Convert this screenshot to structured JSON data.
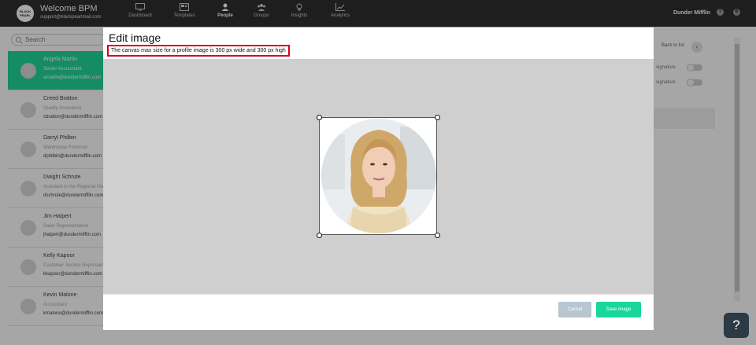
{
  "header": {
    "logo_text": "BLACK PEARL",
    "welcome": "Welcome BPM",
    "support_email": "support@blackpearlmail.com",
    "nav": [
      {
        "label": "Dashboard",
        "icon": "monitor-icon"
      },
      {
        "label": "Templates",
        "icon": "template-icon"
      },
      {
        "label": "People",
        "icon": "person-icon"
      },
      {
        "label": "Groups",
        "icon": "groups-icon"
      },
      {
        "label": "Insights",
        "icon": "lightbulb-icon"
      },
      {
        "label": "Analytics",
        "icon": "chart-icon"
      }
    ],
    "active_nav": "People",
    "company": "Dunder Mifflin",
    "help_icon_glyph": "?",
    "settings_icon_glyph": "⚙"
  },
  "search": {
    "placeholder": "Search"
  },
  "people": [
    {
      "name": "Angela Martin",
      "role": "Senior Accountant",
      "email": "amartin@dundermifflin.com"
    },
    {
      "name": "Creed Bratton",
      "role": "Quality Assurance",
      "email": "cbratton@dundermifflin.com"
    },
    {
      "name": "Darryl Philbin",
      "role": "Warehouse Foreman",
      "email": "dphilbin@dundermifflin.com"
    },
    {
      "name": "Dwight Schrute",
      "role": "Assistant to the Regional Manager",
      "email": "dschrute@dundermifflin.com"
    },
    {
      "name": "Jim Halpert",
      "role": "Sales Representative",
      "email": "jhalpert@dundermifflin.com"
    },
    {
      "name": "Kelly Kapoor",
      "role": "Customer Service Representative",
      "email": "kkapoor@dundermifflin.com"
    },
    {
      "name": "Kevin Malone",
      "role": "Accountant",
      "email": "kmalone@dundermifflin.com"
    }
  ],
  "right_panel": {
    "back_label": "Back to list",
    "back_icon_glyph": "‹",
    "sig_rows": [
      "signature",
      "signature"
    ]
  },
  "modal": {
    "title": "Edit image",
    "note": "The canvas max size for a profile image is 300 px wide and 300 px high",
    "cancel_label": "Cancel",
    "save_label": "Save image"
  },
  "help_button": {
    "label": "?"
  },
  "colors": {
    "accent": "#22d89a",
    "save_button": "#18d79a",
    "cancel_button": "#b7c6cf",
    "note_border": "#d9001b",
    "topbar": "#2f2f2f"
  }
}
